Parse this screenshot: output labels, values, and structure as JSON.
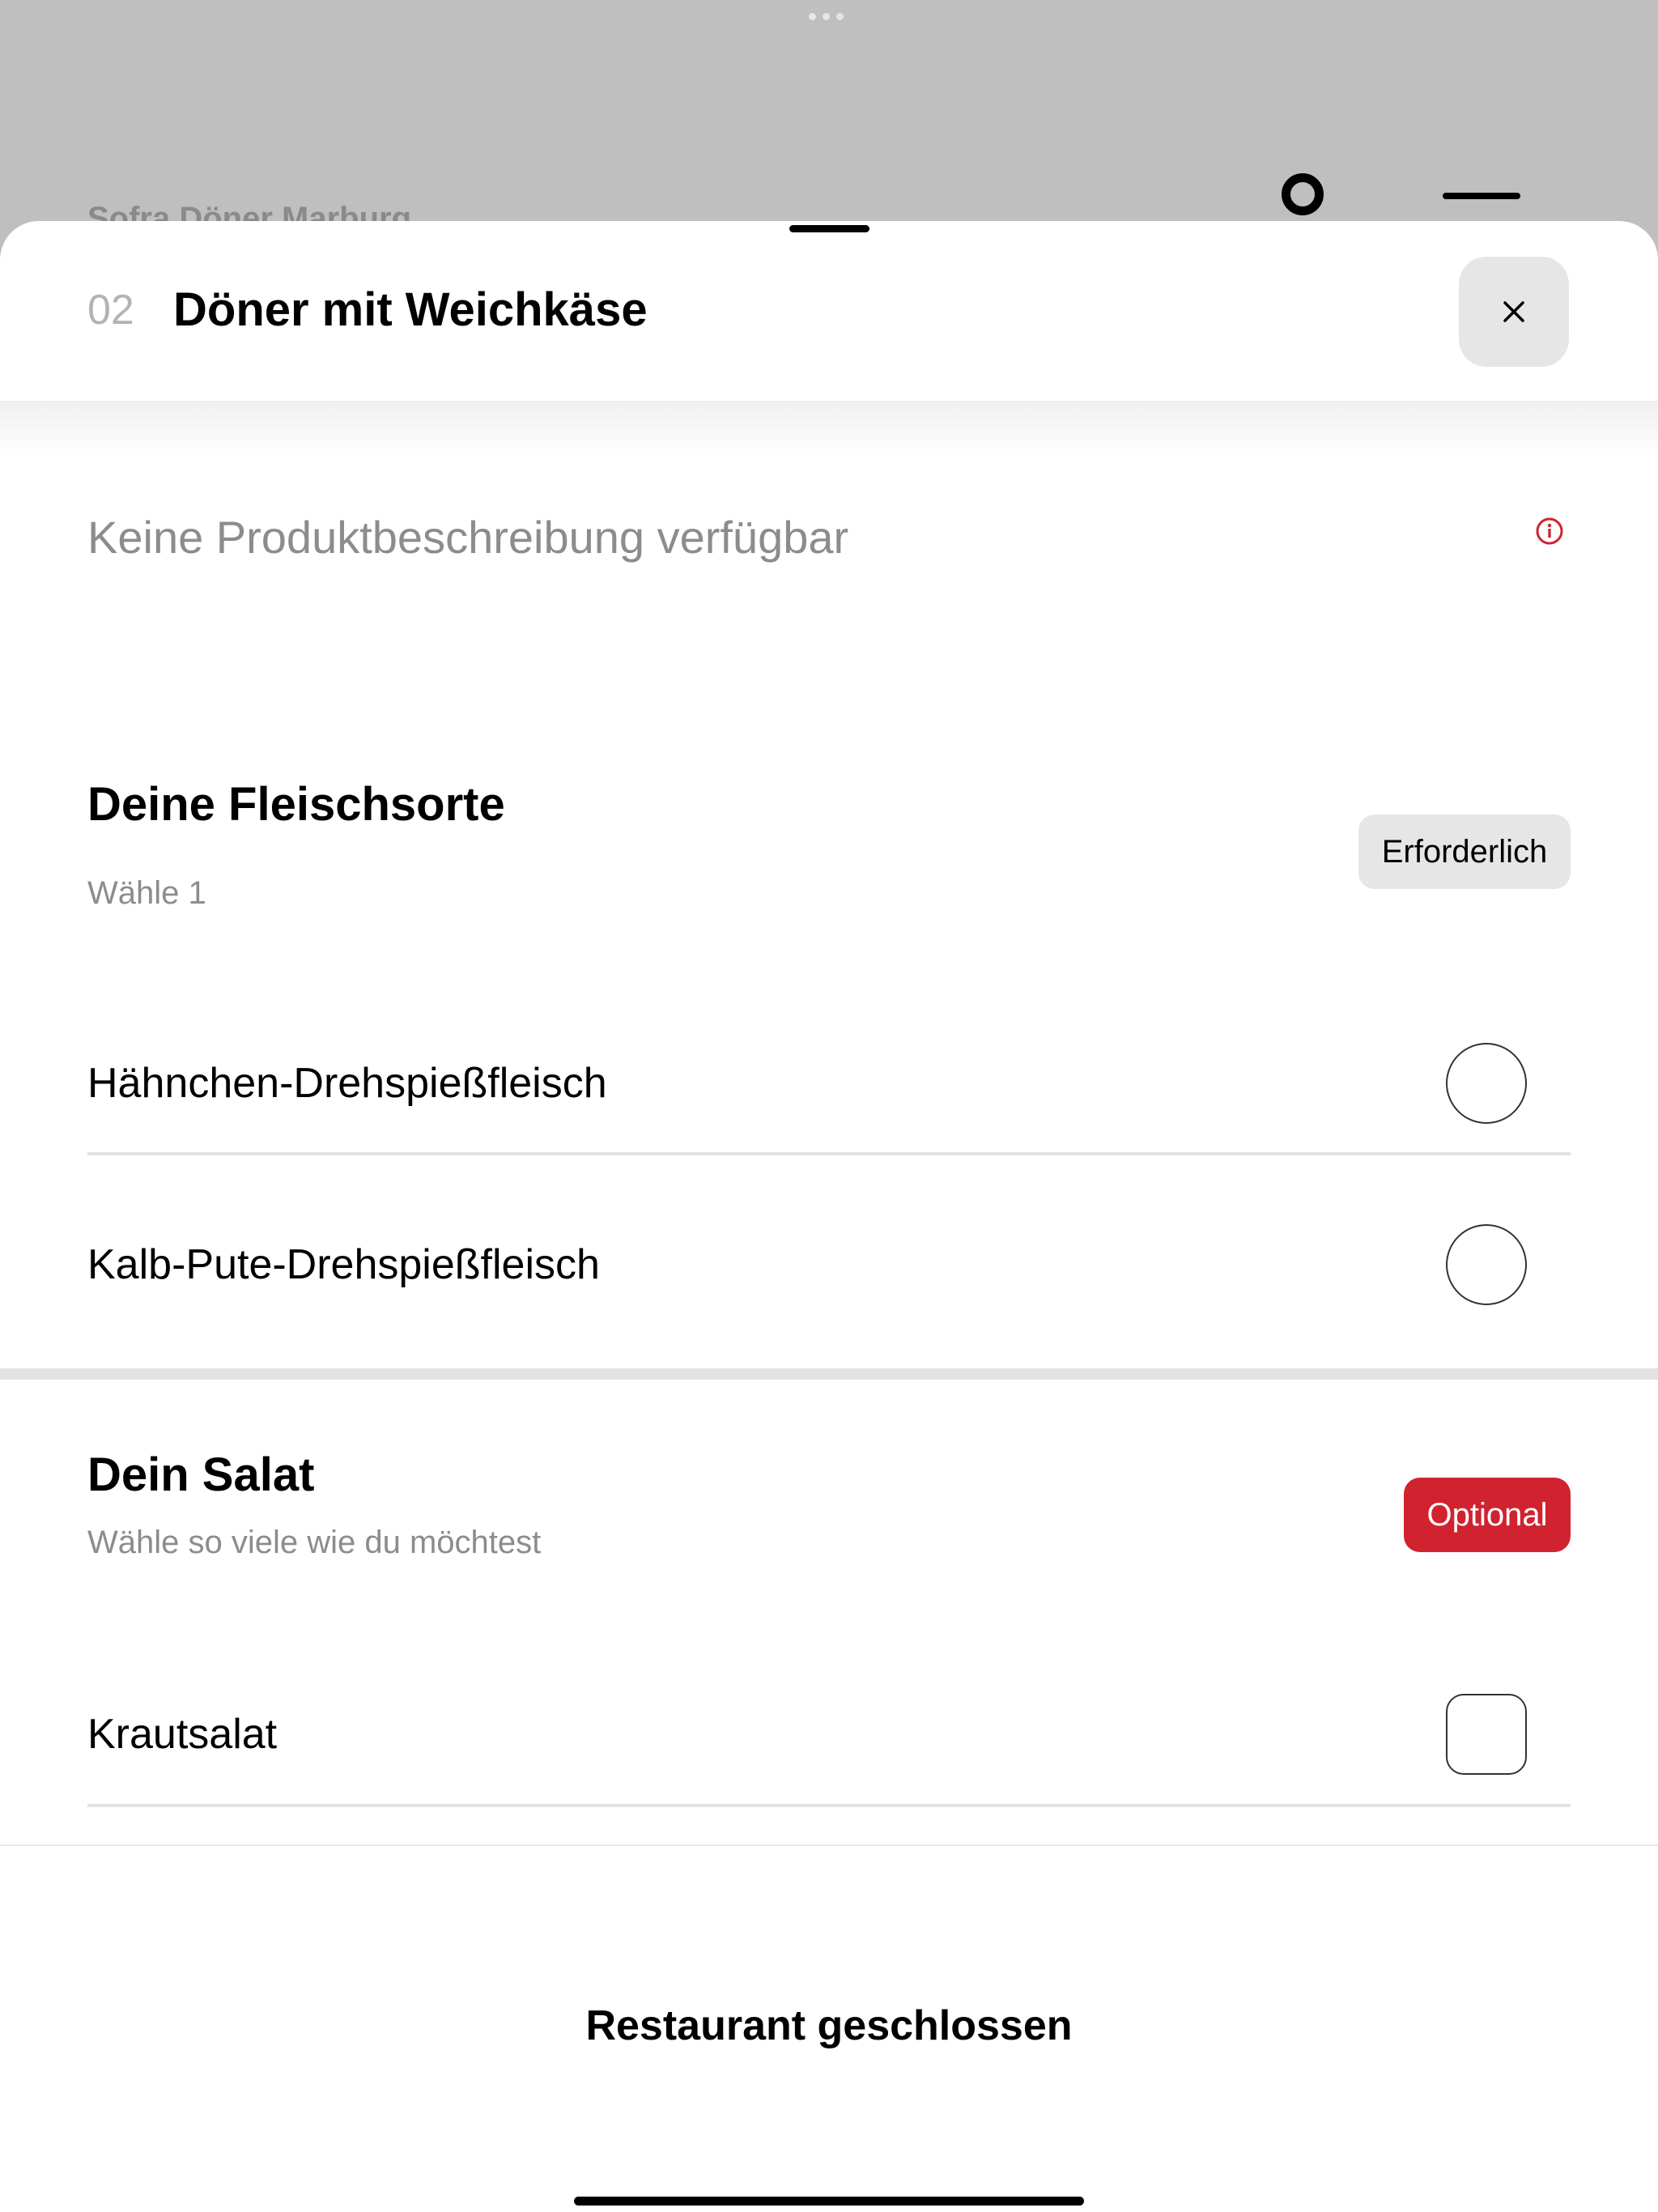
{
  "background": {
    "restaurant_name": "Sofra Döner Marburg",
    "account_icon": "account-circle-icon",
    "menu_icon": "hamburger-menu-icon"
  },
  "sheet": {
    "item_number": "02",
    "item_title": "Döner mit Weichkäse",
    "close_icon": "close-icon",
    "description": "Keine Produktbeschreibung verfügbar",
    "info_icon": "info-icon"
  },
  "meat_section": {
    "title": "Deine Fleischsorte",
    "subtitle": "Wähle 1",
    "badge": "Erforderlich",
    "options": [
      {
        "label": "Hähnchen-Drehspießfleisch",
        "selected": false
      },
      {
        "label": "Kalb-Pute-Drehspießfleisch",
        "selected": false
      }
    ]
  },
  "salad_section": {
    "title": "Dein Salat",
    "subtitle": "Wähle so viele wie du möchtest",
    "badge": "Optional",
    "options": [
      {
        "label": "Krautsalat",
        "checked": false
      }
    ]
  },
  "footer": {
    "status_text": "Restaurant geschlossen"
  },
  "colors": {
    "accent_red": "#d0232f",
    "badge_gray": "#e6e6e6",
    "overlay_gray": "#bfbfbf"
  }
}
